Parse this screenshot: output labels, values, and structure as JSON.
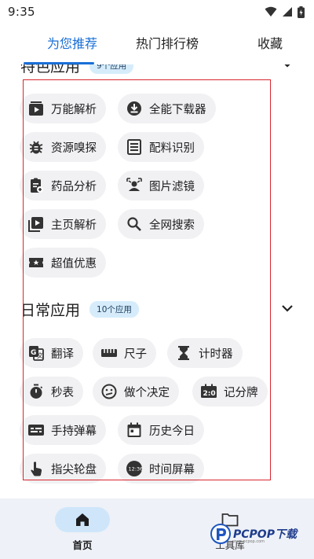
{
  "status_bar": {
    "time": "9:35"
  },
  "tabs": [
    {
      "label": "为您推荐",
      "active": true
    },
    {
      "label": "热门排行榜",
      "active": false
    },
    {
      "label": "收藏",
      "active": false
    }
  ],
  "featured": {
    "title": "特色应用",
    "badge": "9个应用",
    "items": [
      {
        "label": "万能解析",
        "icon": "play-box-icon"
      },
      {
        "label": "全能下载器",
        "icon": "download-icon"
      },
      {
        "label": "资源嗅探",
        "icon": "bug-icon"
      },
      {
        "label": "配料识别",
        "icon": "document-list-icon"
      },
      {
        "label": "药品分析",
        "icon": "medical-note-icon"
      },
      {
        "label": "图片滤镜",
        "icon": "portrait-icon"
      },
      {
        "label": "主页解析",
        "icon": "video-library-icon"
      },
      {
        "label": "全网搜索",
        "icon": "search-icon"
      },
      {
        "label": "超值优惠",
        "icon": "coupon-icon"
      }
    ]
  },
  "daily": {
    "title": "日常应用",
    "badge": "10个应用",
    "items": [
      {
        "label": "翻译",
        "icon": "translate-icon"
      },
      {
        "label": "尺子",
        "icon": "ruler-icon"
      },
      {
        "label": "计时器",
        "icon": "hourglass-icon"
      },
      {
        "label": "秒表",
        "icon": "stopwatch-icon"
      },
      {
        "label": "做个决定",
        "icon": "decision-icon"
      },
      {
        "label": "记分牌",
        "icon": "scoreboard-icon"
      },
      {
        "label": "手持弹幕",
        "icon": "subtitles-icon"
      },
      {
        "label": "历史今日",
        "icon": "calendar-icon"
      },
      {
        "label": "指尖轮盘",
        "icon": "touch-icon"
      },
      {
        "label": "时间屏幕",
        "icon": "clock-screen-icon"
      }
    ]
  },
  "clock_icon_text": "12:36",
  "score_icon_text": "2:0",
  "bottom_nav": [
    {
      "label": "首页",
      "icon": "home-icon",
      "active": true
    },
    {
      "label": "工具库",
      "icon": "folder-icon",
      "active": false
    }
  ],
  "watermark": {
    "text": "PCPOP下载",
    "sub": "www.pcpop.com"
  },
  "colors": {
    "accent": "#1a6fd6",
    "chip_bg": "#f1f1f3",
    "badge_bg": "#d6ecfb",
    "nav_bg": "#eef1f7",
    "nav_pill": "#cfe6fa",
    "highlight": "#d9272e"
  }
}
